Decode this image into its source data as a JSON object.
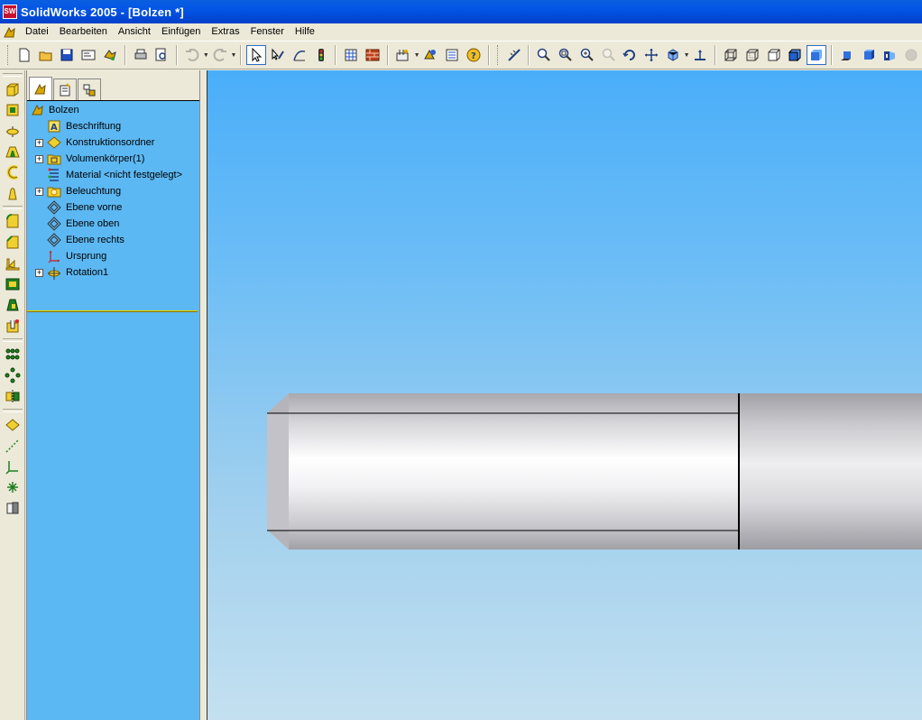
{
  "window": {
    "app_icon_text": "SW",
    "title": "SolidWorks 2005 - [Bolzen *]"
  },
  "menubar": {
    "items": [
      "Datei",
      "Bearbeiten",
      "Ansicht",
      "Einfügen",
      "Extras",
      "Fenster",
      "Hilfe"
    ]
  },
  "feature_tree": {
    "root": "Bolzen",
    "items": [
      {
        "label": "Beschriftung",
        "icon": "annotation-icon",
        "expandable": false
      },
      {
        "label": "Konstruktionsordner",
        "icon": "sensor-folder-icon",
        "expandable": true
      },
      {
        "label": "Volumenkörper(1)",
        "icon": "solid-bodies-icon",
        "expandable": true
      },
      {
        "label": "Material <nicht festgelegt>",
        "icon": "material-icon",
        "expandable": false
      },
      {
        "label": "Beleuchtung",
        "icon": "lighting-icon",
        "expandable": true
      },
      {
        "label": "Ebene vorne",
        "icon": "plane-icon",
        "expandable": false
      },
      {
        "label": "Ebene oben",
        "icon": "plane-icon",
        "expandable": false
      },
      {
        "label": "Ebene rechts",
        "icon": "plane-icon",
        "expandable": false
      },
      {
        "label": "Ursprung",
        "icon": "origin-icon",
        "expandable": false
      },
      {
        "label": "Rotation1",
        "icon": "revolve-icon",
        "expandable": true
      }
    ]
  },
  "colors": {
    "titlebar": "#0355e6",
    "feature_tree_bg": "#5cb8f2",
    "rollback_bar": "#e8d800",
    "viewport_top": "#4aaef9",
    "viewport_bottom": "#c4e0f0"
  }
}
